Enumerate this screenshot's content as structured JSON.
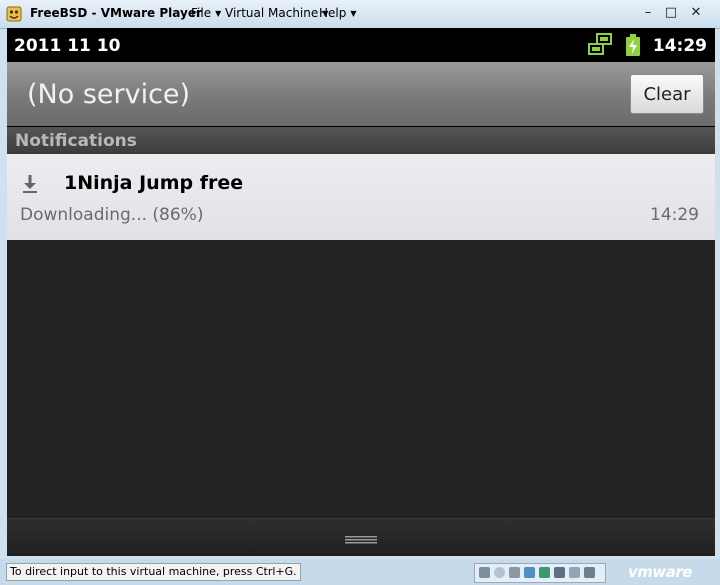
{
  "window": {
    "title": "FreeBSD - VMware Player",
    "menus": [
      "File",
      "Virtual Machine",
      "Help"
    ],
    "controls": {
      "minimize": "–",
      "maximize": "□",
      "close": "✕"
    }
  },
  "statusbar": {
    "date": "2011 11 10",
    "time": "14:29",
    "icons": [
      "network-sync-icon",
      "battery-charging-icon"
    ],
    "accent_color": "#8fd13f"
  },
  "service": {
    "text": "(No service)",
    "clear_label": "Clear"
  },
  "notifications": {
    "header": "Notifications",
    "items": [
      {
        "icon": "download-icon",
        "title": "1Ninja Jump free",
        "status": "Downloading... (86%)",
        "time": "14:29"
      }
    ]
  },
  "vm_status": {
    "hint": "To direct input to this virtual machine, press Ctrl+G.",
    "logo": "vmware"
  }
}
